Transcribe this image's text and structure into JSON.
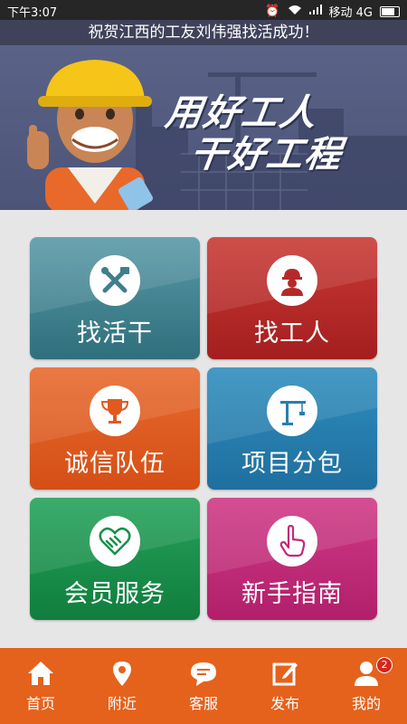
{
  "status_bar": {
    "time": "下午3:07",
    "carrier": "移动 4G"
  },
  "ticker": {
    "text": "祝贺江西的工友刘伟强找活成功！"
  },
  "banner": {
    "slogan_line1": "用好工人",
    "slogan_line2": "干好工程"
  },
  "tiles": [
    {
      "label": "找活干",
      "icon": "tools-icon",
      "color": "#3f7f8c"
    },
    {
      "label": "找工人",
      "icon": "worker-icon",
      "color": "#b52a29"
    },
    {
      "label": "诚信队伍",
      "icon": "trophy-icon",
      "color": "#e05a20"
    },
    {
      "label": "项目分包",
      "icon": "crane-icon",
      "color": "#277fae"
    },
    {
      "label": "会员服务",
      "icon": "handshake-icon",
      "color": "#18904b"
    },
    {
      "label": "新手指南",
      "icon": "hand-pointer-icon",
      "color": "#c22a7a"
    }
  ],
  "tabbar": {
    "accent": "#e5621c",
    "items": [
      {
        "label": "首页",
        "icon": "home-icon"
      },
      {
        "label": "附近",
        "icon": "location-pin-icon"
      },
      {
        "label": "客服",
        "icon": "chat-icon"
      },
      {
        "label": "发布",
        "icon": "edit-icon"
      },
      {
        "label": "我的",
        "icon": "user-icon",
        "badge": "2"
      }
    ]
  }
}
